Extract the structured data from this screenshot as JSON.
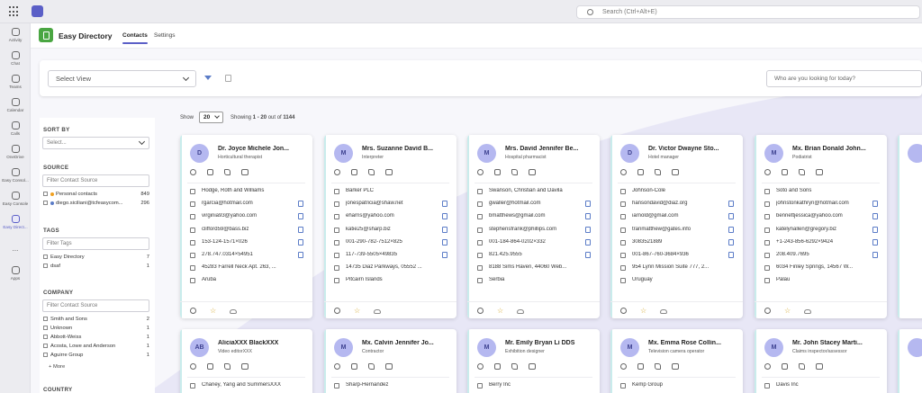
{
  "topbar": {
    "search_placeholder": "Search (Ctrl+Alt+E)"
  },
  "rail": [
    {
      "label": "Activity",
      "icon": "bell-icon"
    },
    {
      "label": "Chat",
      "icon": "chat-icon"
    },
    {
      "label": "Teams",
      "icon": "teams-icon"
    },
    {
      "label": "Calendar",
      "icon": "calendar-icon"
    },
    {
      "label": "Calls",
      "icon": "phone-icon"
    },
    {
      "label": "OneDrive",
      "icon": "cloud-icon"
    },
    {
      "label": "Easy Consol...",
      "icon": "app-icon"
    },
    {
      "label": "Easy Console",
      "icon": "app-icon"
    },
    {
      "label": "Easy Direct...",
      "icon": "app-icon"
    },
    {
      "label": "...",
      "icon": "more-icon"
    },
    {
      "label": "Apps",
      "icon": "apps-icon"
    }
  ],
  "app": {
    "title": "Easy Directory",
    "tabs": [
      "Contacts",
      "Settings"
    ]
  },
  "toolbar": {
    "select_view": "Select View",
    "search_placeholder": "Who are you looking for today?"
  },
  "sidebar": {
    "sort_title": "SORT BY",
    "sort_placeholder": "Select...",
    "source_title": "SOURCE",
    "source_filter": "Filter Contact Source",
    "source_items": [
      {
        "label": "Personal contacts",
        "count": "849"
      },
      {
        "label": "diego.siciliani@tcfeasycom...",
        "count": "296"
      }
    ],
    "tags_title": "TAGS",
    "tags_filter": "Filter Tags",
    "tags_items": [
      {
        "label": "Easy Directory",
        "count": "7"
      },
      {
        "label": "dsaf",
        "count": "1"
      }
    ],
    "company_title": "COMPANY",
    "company_filter": "Filter Contact Source",
    "company_items": [
      {
        "label": "Smith and Sons",
        "count": "2"
      },
      {
        "label": "Unknown",
        "count": "1"
      },
      {
        "label": "Abbott-Weiss",
        "count": "1"
      },
      {
        "label": "Acosta, Lowe and Anderson",
        "count": "1"
      },
      {
        "label": "Aguirre Group",
        "count": "1"
      }
    ],
    "more": "+ More",
    "country_title": "COUNTRY"
  },
  "pager": {
    "show": "Show",
    "page_size": "20",
    "showing_prefix": "Showing ",
    "range": "1 - 20",
    "of_text": " out of ",
    "total": "1144"
  },
  "cards": [
    {
      "initials": "D",
      "name": "Dr. Joyce Michele Jon...",
      "title": "Horticultural therapist",
      "fields": [
        "Hodge, Roth and Williams",
        "rgarcia@hotmail.com",
        "virginia93@yahoo.com",
        "clifford59@bass.biz",
        "153-124-1571×026",
        "278.747.0314×54951",
        "45283 Farrell Neck Apt. 263, ...",
        "Aruba"
      ]
    },
    {
      "initials": "M",
      "name": "Mrs. Suzanne David B...",
      "title": "Interpreter",
      "fields": [
        "Barker PLC",
        "jonespatricia@shaw.net",
        "eharris@yahoo.com",
        "katie25@sharp.biz",
        "001-290-782-7512×825",
        "117-739-5505×49835",
        "14735 Diaz Parkways, 05552 ...",
        "Pitcairn Islands"
      ]
    },
    {
      "initials": "M",
      "name": "Mrs. David Jennifer Be...",
      "title": "Hospital pharmacist",
      "fields": [
        "Swanson, Christian and Davila",
        "gwaller@hotmail.com",
        "bmatthews@gmail.com",
        "stephensfrank@phillips.com",
        "001-184-864-0202×332",
        "821.425.9555",
        "8188 Sims Haven, 44060 Web...",
        "Serbia"
      ]
    },
    {
      "initials": "D",
      "name": "Dr. Victor Dwayne Sto...",
      "title": "Hotel manager",
      "fields": [
        "Johnson-Cole",
        "hansondavid@diaz.org",
        "iarnold@gmail.com",
        "tranmatthew@gates.info",
        "3083521889",
        "001-867-760-3684×936",
        "954 Lynn Mission Suite 777, 2...",
        "Uruguay"
      ]
    },
    {
      "initials": "M",
      "name": "Mx. Brian Donald John...",
      "title": "Podiatrist",
      "fields": [
        "Soto and Sons",
        "johnstonkathryn@hotmail.com",
        "bennettjessica@yahoo.com",
        "katelynallen@gregory.biz",
        "+1-243-856-6292×9424",
        "208.409.7695",
        "6034 Finley Springs, 14567 W...",
        "Palau"
      ]
    }
  ],
  "cards_row2": [
    {
      "initials": "AB",
      "name": "AliciaXXX BlackXXX",
      "title": "Video editorXXX",
      "fields": [
        "Chaney, Yang and SummersXXX"
      ]
    },
    {
      "initials": "M",
      "name": "Mx. Calvin Jennifer Jo...",
      "title": "Contractor",
      "fields": [
        "Sharp-Hernandez"
      ]
    },
    {
      "initials": "M",
      "name": "Mr. Emily Bryan Li DDS",
      "title": "Exhibition designer",
      "fields": [
        "Berry Inc"
      ]
    },
    {
      "initials": "M",
      "name": "Mx. Emma Rose Collin...",
      "title": "Television camera operator",
      "fields": [
        "Kemp Group"
      ]
    },
    {
      "initials": "M",
      "name": "Mr. John Stacey Marti...",
      "title": "Claims inspector/assessor",
      "fields": [
        "Davis Inc"
      ]
    }
  ],
  "colors": {
    "accent": "#5b5fc7",
    "avatar_bg": "#b5b8f0",
    "star": "#d4a72c",
    "logo": "#4aa642"
  }
}
